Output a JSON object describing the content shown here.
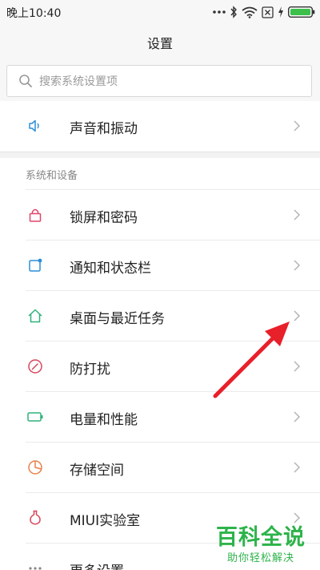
{
  "status_bar": {
    "time": "晚上10:40",
    "icons": [
      "more-dots-icon",
      "bluetooth-icon",
      "wifi-icon",
      "no-sim-icon",
      "charging-icon",
      "battery-icon"
    ],
    "battery_color": "#3cc04a"
  },
  "header": {
    "title": "设置"
  },
  "search": {
    "placeholder": "搜索系统设置项",
    "value": ""
  },
  "top_items": [
    {
      "label": "声音和振动",
      "icon": "speaker-icon",
      "icon_color": "#2a8fd8"
    }
  ],
  "section": {
    "header": "系统和设备",
    "items": [
      {
        "label": "锁屏和密码",
        "icon": "lock-icon",
        "icon_color": "#e2456a"
      },
      {
        "label": "通知和状态栏",
        "icon": "notification-icon",
        "icon_color": "#2a8fd8"
      },
      {
        "label": "桌面与最近任务",
        "icon": "home-icon",
        "icon_color": "#2fb27a"
      },
      {
        "label": "防打扰",
        "icon": "do-not-disturb-icon",
        "icon_color": "#d8455a"
      },
      {
        "label": "电量和性能",
        "icon": "battery-outline-icon",
        "icon_color": "#2fb27a"
      },
      {
        "label": "存储空间",
        "icon": "pie-chart-icon",
        "icon_color": "#e8804a"
      },
      {
        "label": "MIUI实验室",
        "icon": "flask-icon",
        "icon_color": "#d8455a"
      },
      {
        "label": "更多设置",
        "icon": "more-dots-icon",
        "icon_color": "#888888"
      }
    ]
  },
  "annotation": {
    "arrow_color": "#e8202a",
    "points_to": "桌面与最近任务"
  },
  "watermark": {
    "title": "百科全说",
    "subtitle": "助你轻松解决",
    "color": "#2db34a"
  }
}
